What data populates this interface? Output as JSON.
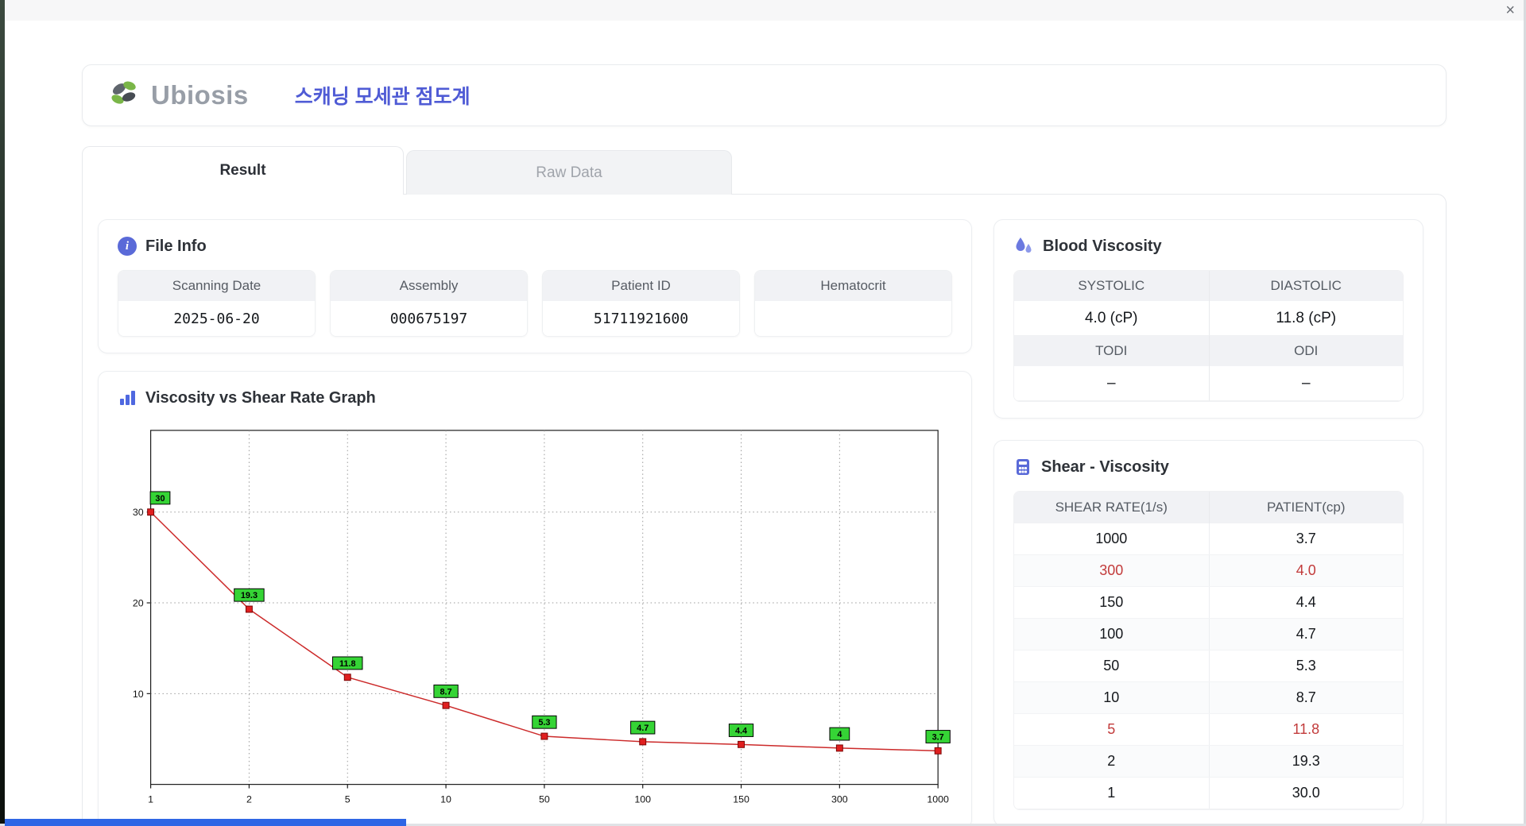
{
  "window": {
    "close_label": "×"
  },
  "header": {
    "brand": "Ubiosis",
    "app_title": "스캐닝 모세관 점도계"
  },
  "tabs": {
    "result": "Result",
    "raw_data": "Raw Data"
  },
  "file_info": {
    "title": "File Info",
    "fields": [
      {
        "label": "Scanning Date",
        "value": "2025-06-20"
      },
      {
        "label": "Assembly",
        "value": "000675197"
      },
      {
        "label": "Patient ID",
        "value": "51711921600"
      },
      {
        "label": "Hematocrit",
        "value": ""
      }
    ]
  },
  "blood_viscosity": {
    "title": "Blood Viscosity",
    "rows": [
      {
        "type": "header",
        "cells": [
          "SYSTOLIC",
          "DIASTOLIC"
        ]
      },
      {
        "type": "value",
        "cells": [
          "4.0 (cP)",
          "11.8 (cP)"
        ]
      },
      {
        "type": "header",
        "cells": [
          "TODI",
          "ODI"
        ]
      },
      {
        "type": "value",
        "cells": [
          "–",
          "–"
        ]
      }
    ]
  },
  "graph_panel": {
    "title": "Viscosity vs Shear Rate Graph"
  },
  "chart_data": {
    "type": "line",
    "title": "Viscosity vs Shear Rate Graph",
    "x_scale": "log-like, ticks evenly spaced",
    "x": [
      1,
      2,
      5,
      10,
      50,
      100,
      150,
      300,
      1000
    ],
    "x_ticks": [
      "1",
      "2",
      "5",
      "10",
      "50",
      "100",
      "150",
      "300",
      "1000"
    ],
    "values": [
      30,
      19.3,
      11.8,
      8.7,
      5.3,
      4.7,
      4.4,
      4,
      3.7
    ],
    "point_labels": [
      "30",
      "19.3",
      "11.8",
      "8.7",
      "5.3",
      "4.7",
      "4.4",
      "4",
      "3.7"
    ],
    "y_ticks": [
      10,
      20,
      30
    ],
    "ylim": [
      0,
      39
    ],
    "grid": true,
    "legend": false,
    "line_color": "#cc2a2a",
    "marker_color": "#e01f1f",
    "marker_border": "#7a0505",
    "label_bg": "#35d435",
    "label_border": "#000000"
  },
  "shear_table": {
    "title": "Shear - Viscosity",
    "columns": [
      "SHEAR RATE(1/s)",
      "PATIENT(cp)"
    ],
    "rows": [
      {
        "shear_rate": "1000",
        "patient": "3.7",
        "highlight": false
      },
      {
        "shear_rate": "300",
        "patient": "4.0",
        "highlight": true
      },
      {
        "shear_rate": "150",
        "patient": "4.4",
        "highlight": false
      },
      {
        "shear_rate": "100",
        "patient": "4.7",
        "highlight": false
      },
      {
        "shear_rate": "50",
        "patient": "5.3",
        "highlight": false
      },
      {
        "shear_rate": "10",
        "patient": "8.7",
        "highlight": false
      },
      {
        "shear_rate": "5",
        "patient": "11.8",
        "highlight": true
      },
      {
        "shear_rate": "2",
        "patient": "19.3",
        "highlight": false
      },
      {
        "shear_rate": "1",
        "patient": "30.0",
        "highlight": false
      }
    ]
  },
  "colors": {
    "accent_blue": "#4f5bd5",
    "icon_blue": "#5a6ad8",
    "highlight_red": "#c23b3b",
    "brand_green": "#7ab648",
    "brand_gray": "#989ea7"
  }
}
